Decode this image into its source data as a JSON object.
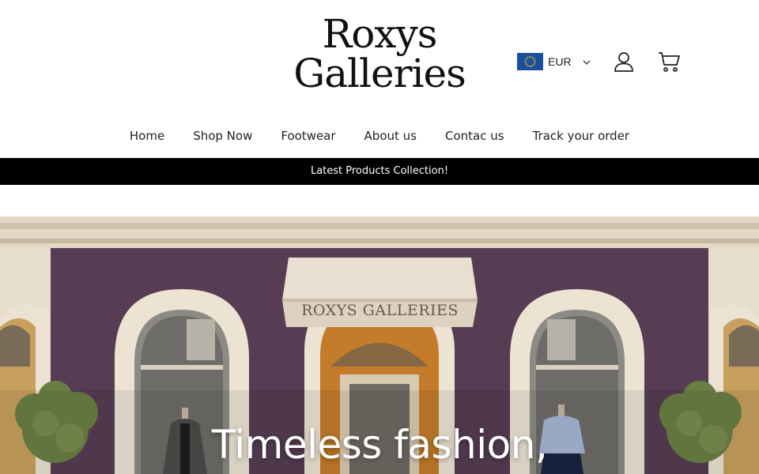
{
  "brand": {
    "line1": "Roxys",
    "line2": "Galleries"
  },
  "currency": {
    "code": "EUR",
    "flag_icon": "eu-flag-icon"
  },
  "icons": {
    "account": "user-icon",
    "cart": "cart-icon",
    "dropdown": "chevron-down-icon"
  },
  "nav": [
    {
      "label": "Home"
    },
    {
      "label": "Shop Now"
    },
    {
      "label": "Footwear"
    },
    {
      "label": "About us"
    },
    {
      "label": "Contac us"
    },
    {
      "label": "Track your order"
    }
  ],
  "announcement": {
    "text": "Latest Products Collection!"
  },
  "hero": {
    "sign_text": "ROXYS GALLERIES",
    "headline": "Timeless fashion,"
  },
  "colors": {
    "announcement_bg": "#000000",
    "facade": "#5a4157",
    "trim": "#e6dccb",
    "flag": "#1a4fa0"
  }
}
